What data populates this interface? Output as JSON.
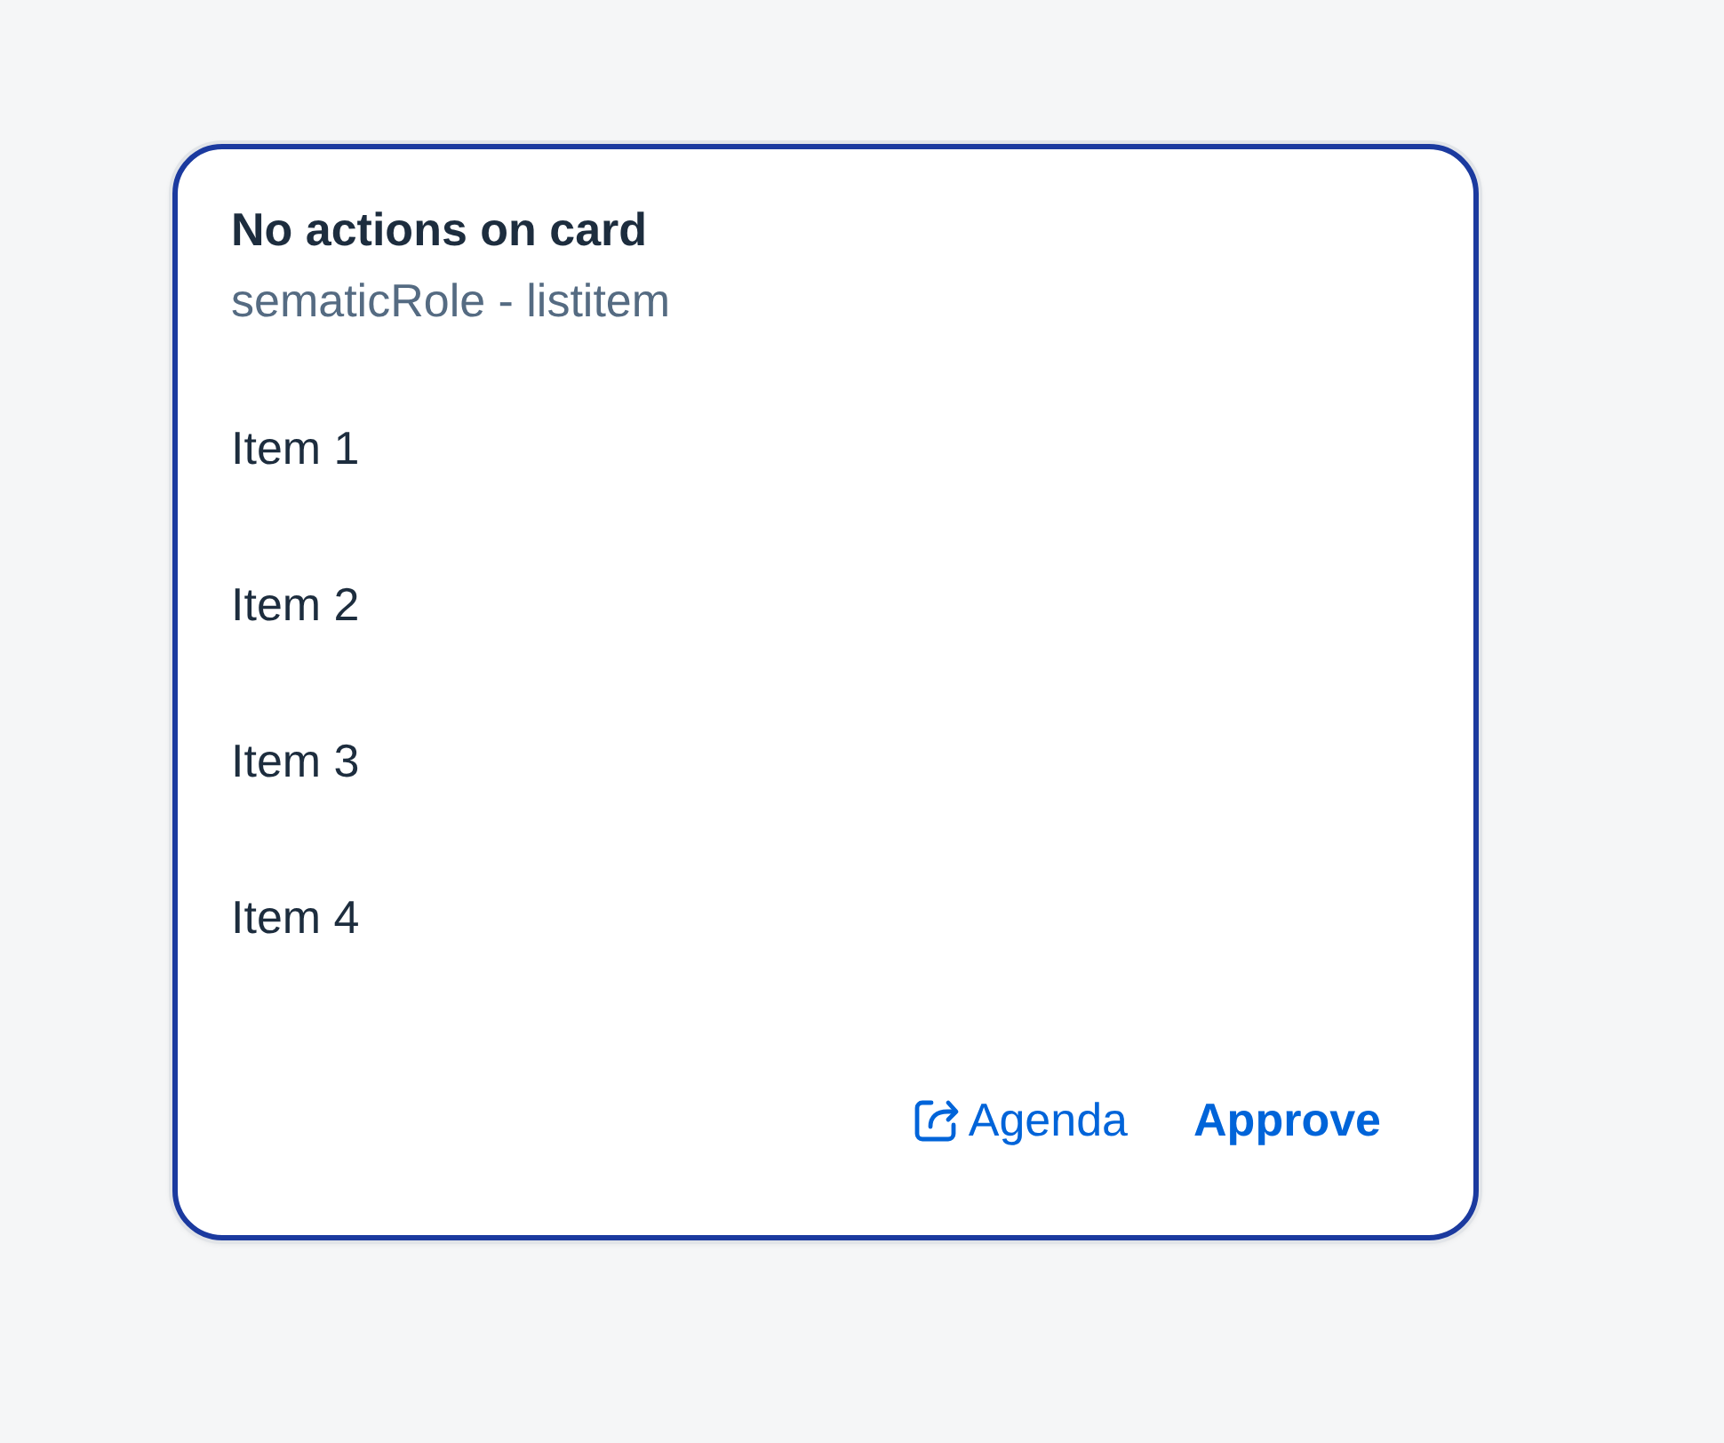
{
  "card": {
    "focused": true,
    "title": "No actions on card",
    "subtitle": "sematicRole - listitem",
    "items": [
      {
        "label": "Item 1"
      },
      {
        "label": "Item 2"
      },
      {
        "label": "Item 3"
      },
      {
        "label": "Item 4"
      }
    ],
    "actions": [
      {
        "kind": "link",
        "label": "Agenda"
      },
      {
        "kind": "button",
        "label": "Approve"
      }
    ]
  }
}
